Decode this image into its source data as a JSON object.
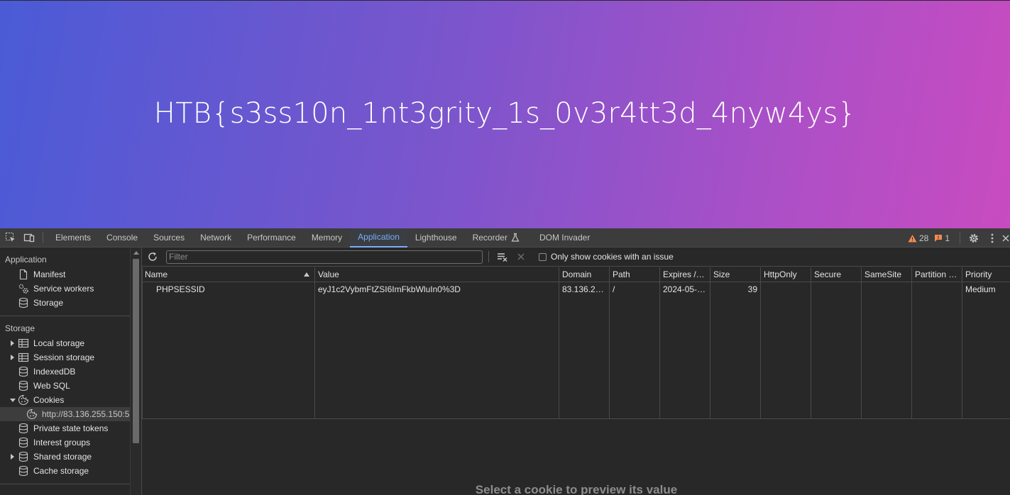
{
  "page": {
    "flag_text": "HTB{s3ss10n_1nt3grity_1s_0v3r4tt3d_4nyw4ys}"
  },
  "devtools": {
    "tabs": [
      {
        "label": "Elements"
      },
      {
        "label": "Console"
      },
      {
        "label": "Sources"
      },
      {
        "label": "Network"
      },
      {
        "label": "Performance"
      },
      {
        "label": "Memory"
      },
      {
        "label": "Application",
        "active": true
      },
      {
        "label": "Lighthouse"
      },
      {
        "label": "Recorder"
      },
      {
        "label": "DOM Invader"
      }
    ],
    "warnings_count": "28",
    "issues_count": "1",
    "colors": {
      "accent": "#7cacf8",
      "warning": "#f28b54",
      "issue": "#f28b54"
    }
  },
  "sidebar": {
    "application_header": "Application",
    "application_items": [
      {
        "label": "Manifest",
        "icon": "file-icon"
      },
      {
        "label": "Service workers",
        "icon": "gears-icon"
      },
      {
        "label": "Storage",
        "icon": "database-icon"
      }
    ],
    "storage_header": "Storage",
    "storage_items": [
      {
        "label": "Local storage",
        "icon": "table-icon",
        "expander": "collapsed"
      },
      {
        "label": "Session storage",
        "icon": "table-icon",
        "expander": "collapsed"
      },
      {
        "label": "IndexedDB",
        "icon": "database-icon"
      },
      {
        "label": "Web SQL",
        "icon": "database-icon"
      },
      {
        "label": "Cookies",
        "icon": "cookie-icon",
        "expander": "expanded"
      },
      {
        "label": "http://83.136.255.150:5",
        "icon": "cookie-icon",
        "child": true,
        "selected": true
      },
      {
        "label": "Private state tokens",
        "icon": "database-icon"
      },
      {
        "label": "Interest groups",
        "icon": "database-icon"
      },
      {
        "label": "Shared storage",
        "icon": "database-icon",
        "expander": "collapsed"
      },
      {
        "label": "Cache storage",
        "icon": "database-icon"
      }
    ]
  },
  "cookies": {
    "filter_placeholder": "Filter",
    "only_issues_label": "Only show cookies with an issue",
    "columns": [
      "Name",
      "Value",
      "Domain",
      "Path",
      "Expires /…",
      "Size",
      "HttpOnly",
      "Secure",
      "SameSite",
      "Partition …",
      "Priority"
    ],
    "rows": [
      {
        "name": "PHPSESSID",
        "value": "eyJ1c2VybmFtZSI6ImFkbWluIn0%3D",
        "domain": "83.136.2…",
        "path": "/",
        "expires": "2024-05-…",
        "size": "39",
        "httponly": "",
        "secure": "",
        "samesite": "",
        "partition": "",
        "priority": "Medium"
      }
    ],
    "preview_placeholder": "Select a cookie to preview its value"
  }
}
